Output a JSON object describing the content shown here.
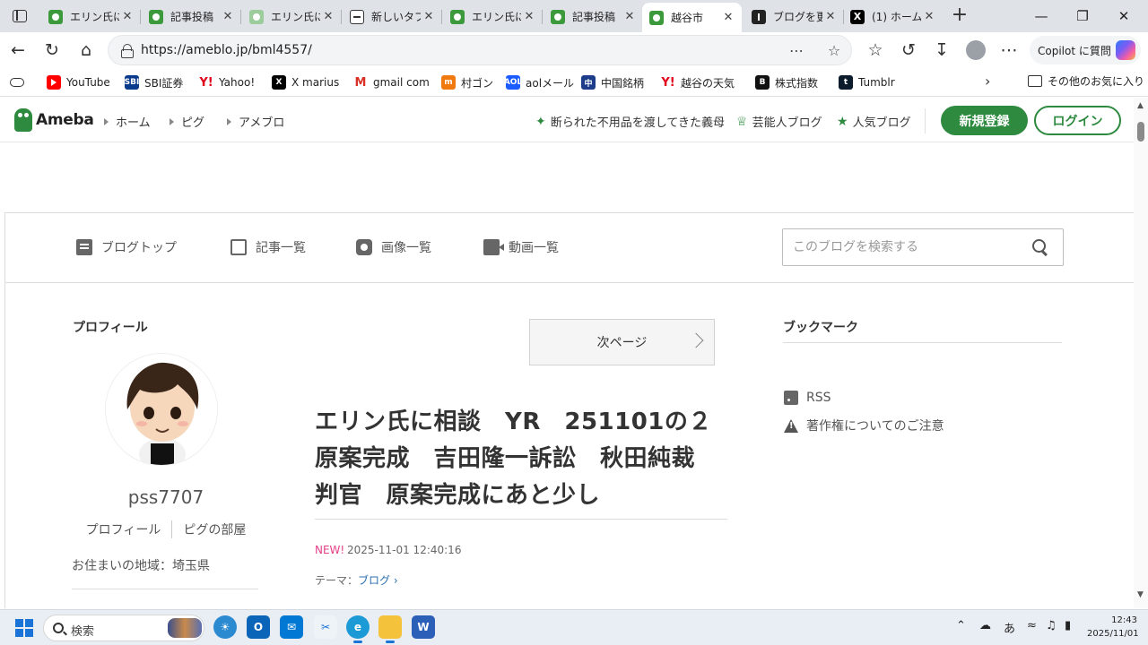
{
  "browser": {
    "tabs": [
      {
        "label": "エリン氏に",
        "icon": "ameba-frog-icon"
      },
      {
        "label": "記事投稿",
        "icon": "ameba-frog-icon"
      },
      {
        "label": "エリン氏に",
        "icon": "ameba-frog-faded-icon"
      },
      {
        "label": "新しいタブ",
        "icon": "newtab-icon"
      },
      {
        "label": "エリン氏に",
        "icon": "ameba-frog-icon"
      },
      {
        "label": "記事投稿",
        "icon": "ameba-frog-icon"
      },
      {
        "label": "越谷市",
        "icon": "ameba-frog-icon",
        "active": true
      },
      {
        "label": "ブログを更",
        "icon": "info-icon"
      },
      {
        "label": "(1) ホーム",
        "icon": "x-icon"
      }
    ],
    "tab_close_glyph": "✕",
    "url": "https://ameblo.jp/bml4557/",
    "copilot_label": "Copilot に質問"
  },
  "bookmarks": [
    {
      "label": "YouTube",
      "icon": "youtube-icon"
    },
    {
      "label": "SBI証券",
      "icon": "sbi-icon",
      "glyph": "SBI"
    },
    {
      "label": "Yahoo!",
      "icon": "yahoo-icon",
      "glyph": "Y!"
    },
    {
      "label": "X marius",
      "icon": "x-icon",
      "glyph": "X"
    },
    {
      "label": "gmail com",
      "icon": "gmail-icon",
      "glyph": "M"
    },
    {
      "label": "村ゴン",
      "icon": "murgon-icon",
      "glyph": "m"
    },
    {
      "label": "aolメール",
      "icon": "aol-icon",
      "glyph": "AOL"
    },
    {
      "label": "中国銘柄",
      "icon": "china-stock-icon",
      "glyph": "中"
    },
    {
      "label": "越谷の天気",
      "icon": "yahoo-icon",
      "glyph": "Y!"
    },
    {
      "label": "株式指数",
      "icon": "b-icon",
      "glyph": "B"
    },
    {
      "label": "Tumblr",
      "icon": "tumblr-icon",
      "glyph": "t"
    }
  ],
  "bookmarks_other": "その他のお気に入り",
  "ameba": {
    "logo": "Ameba",
    "nav": [
      "ホーム",
      "ピグ",
      "アメブロ"
    ],
    "picks": [
      "断られた不用品を渡してきた義母",
      "芸能人ブログ",
      "人気ブログ"
    ],
    "register": "新規登録",
    "login": "ログイン"
  },
  "blog_menu": {
    "items": [
      "ブログトップ",
      "記事一覧",
      "画像一覧",
      "動画一覧"
    ],
    "search_placeholder": "このブログを検索する"
  },
  "profile": {
    "title": "プロフィール",
    "username": "pss7707",
    "links": [
      "プロフィール",
      "ピグの部屋"
    ],
    "residence": "お住まいの地域：埼玉県"
  },
  "article": {
    "next_page": "次ページ",
    "title_lines": [
      "エリン氏に相談　YR　251101の２",
      "原案完成　吉田隆一訴訟　秋田純裁",
      "判官　原案完成にあと少し"
    ],
    "new_badge": "NEW!",
    "date": "2025-11-01 12:40:16",
    "theme_label": "テーマ：",
    "theme": "ブログ"
  },
  "bookmark_side": {
    "title": "ブックマーク",
    "links": [
      "RSS",
      "著作権についてのご注意"
    ]
  },
  "taskbar": {
    "search_label": "検索",
    "ime": "あ",
    "time": "12:43",
    "date": "2025/11/01"
  }
}
